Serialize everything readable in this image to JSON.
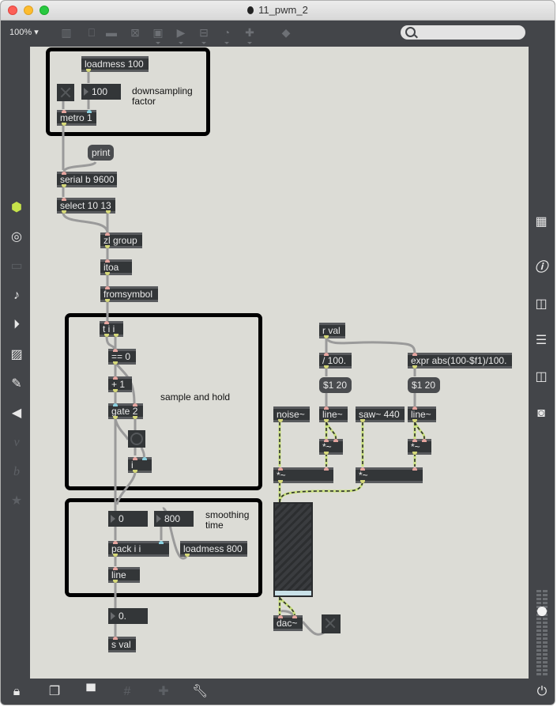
{
  "window": {
    "title": "11_pwm_2"
  },
  "toolbar": {
    "zoom_level": "100%",
    "icons": [
      "presentation-icon",
      "message-icon",
      "comment-icon",
      "toggle-icon",
      "button-icon",
      "number-icon",
      "slider-icon",
      "dial-icon",
      "add-object-icon",
      "paint-bucket-icon"
    ],
    "search": {
      "value": "",
      "placeholder": ""
    }
  },
  "left_sidebar": {
    "items": [
      {
        "name": "cube-icon",
        "glyph": "⬢",
        "active": true
      },
      {
        "name": "target-icon",
        "glyph": "◎"
      },
      {
        "name": "device-icon",
        "glyph": "▭",
        "dim": true
      },
      {
        "name": "music-note-icon",
        "glyph": "♪"
      },
      {
        "name": "media-player-icon",
        "glyph": "⏵"
      },
      {
        "name": "image-icon",
        "glyph": "▨"
      },
      {
        "name": "paperclip-icon",
        "glyph": "📎"
      },
      {
        "name": "plug-icon",
        "glyph": "⏻"
      },
      {
        "name": "vimeo-icon",
        "glyph": "v",
        "dim": true
      },
      {
        "name": "bandcamp-icon",
        "glyph": "b",
        "dim": true
      },
      {
        "name": "star-icon",
        "glyph": "★",
        "dim": true
      }
    ]
  },
  "right_sidebar": {
    "items": [
      {
        "name": "grid-keyboard-icon",
        "glyph": "▦"
      },
      {
        "name": "info-icon",
        "glyph": "i"
      },
      {
        "name": "reference-book-icon",
        "glyph": "▯"
      },
      {
        "name": "list-icon",
        "glyph": "☰"
      },
      {
        "name": "help-book-icon",
        "glyph": "▯"
      },
      {
        "name": "snapshot-camera-icon",
        "glyph": "◙"
      }
    ],
    "volume_level": 0.75
  },
  "bottom_bar": {
    "items": [
      {
        "name": "lock-icon",
        "glyph": "🔒"
      },
      {
        "name": "windows-icon",
        "glyph": "❐"
      },
      {
        "name": "presentation-mode-icon",
        "glyph": "⌂"
      },
      {
        "name": "grid-icon",
        "glyph": "#",
        "dim": true
      },
      {
        "name": "add-attachment-icon",
        "glyph": "+",
        "dim": true
      },
      {
        "name": "wrench-icon",
        "glyph": "🔧"
      }
    ],
    "power_icon": "⏻"
  },
  "patch": {
    "comments": {
      "downsampling": "downsampling\nfactor",
      "sample_hold": "sample and hold",
      "smoothing": "smoothing\ntime"
    },
    "objects": {
      "loadmess100": "loadmess 100",
      "num100": "100",
      "metro": "metro 1",
      "print": "print",
      "serial": "serial b 9600",
      "select": "select 10 13",
      "zlgroup": "zl group",
      "itoa": "itoa",
      "fromsymbol": "fromsymbol",
      "tii": "t i i",
      "eq0": "== 0",
      "plus1": "+ 1",
      "gate2": "gate 2",
      "i": "i",
      "num0": "0",
      "num800": "800",
      "pack": "pack i i",
      "loadmess800": "loadmess 800",
      "line": "line",
      "num0f": "0.",
      "sval": "s val",
      "rval": "r val",
      "div100": "/ 100.",
      "expr": "expr abs(100-$f1)/100.",
      "msg1": "$1 20",
      "msg2": "$1 20",
      "noise": "noise~",
      "line1": "line~",
      "saw": "saw~ 440",
      "line2": "line~",
      "mul1": "*~",
      "mul2": "*~",
      "mul3": "*~",
      "mul4": "*~",
      "dac": "dac~"
    }
  }
}
